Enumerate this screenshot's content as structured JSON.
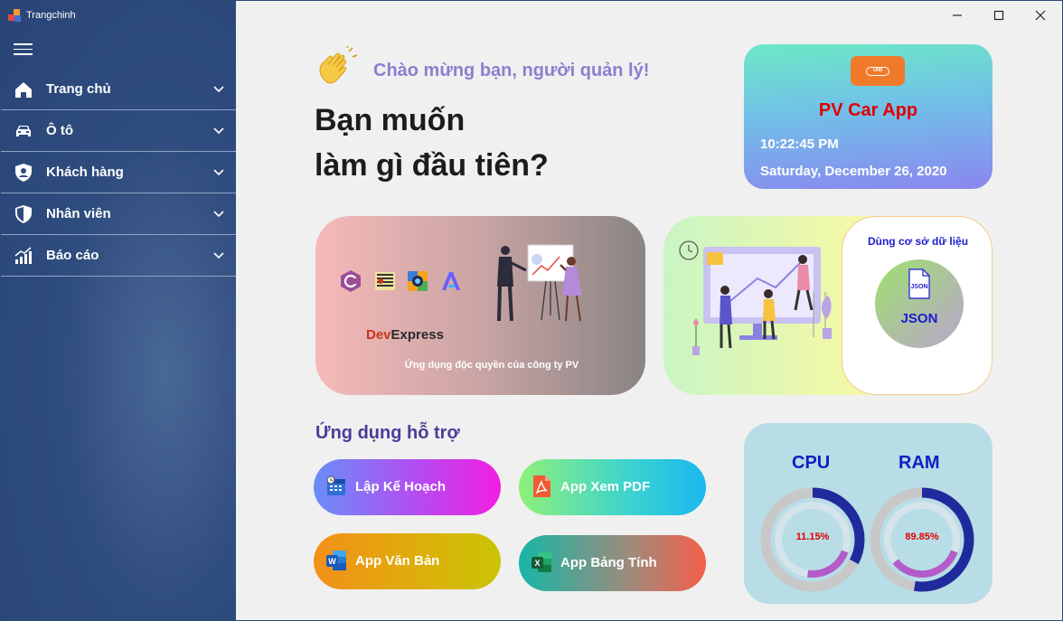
{
  "window": {
    "title": "Trangchinh"
  },
  "sidebar": {
    "items": [
      {
        "label": "Trang chủ",
        "icon": "home-icon"
      },
      {
        "label": "Ô tô",
        "icon": "car-icon"
      },
      {
        "label": "Khách hàng",
        "icon": "user-shield-icon"
      },
      {
        "label": "Nhân viên",
        "icon": "shield-icon"
      },
      {
        "label": "Báo cáo",
        "icon": "chart-icon"
      }
    ]
  },
  "header": {
    "greeting": "Chào mừng bạn, người quản lý!",
    "heading_line1": "Bạn muốn",
    "heading_line2": "làm gì đầu tiên?"
  },
  "clock_card": {
    "badge_text": "UNI",
    "app_name": "PV Car App",
    "time": "10:22:45 PM",
    "date": "Saturday, December 26, 2020"
  },
  "pv_card": {
    "devexpress_part1": "Dev",
    "devexpress_part2": "Express",
    "caption": "Ứng dụng độc quyền của công ty PV"
  },
  "db_card": {
    "title": "Dùng cơ sở dữ liệu",
    "file_icon_text": "JSON",
    "label": "JSON"
  },
  "support": {
    "title": "Ứng dụng hỗ trợ",
    "apps": [
      {
        "label": "Lập Kế Hoạch",
        "icon": "calendar-icon"
      },
      {
        "label": "App Xem PDF",
        "icon": "pdf-icon"
      },
      {
        "label": "App Văn Bản",
        "icon": "word-icon"
      },
      {
        "label": "App Bảng Tính",
        "icon": "excel-icon"
      }
    ]
  },
  "performance": {
    "cpu_label": "CPU",
    "ram_label": "RAM",
    "cpu_value": "11.15%",
    "ram_value": "89.85%",
    "cpu_fraction": 0.1115,
    "ram_fraction": 0.8985
  },
  "colors": {
    "sidebar": "#2f4c7e",
    "accent_red": "#e00000",
    "gauge_track": "#c8c8c8",
    "gauge_fill": "#1f2b9c"
  }
}
